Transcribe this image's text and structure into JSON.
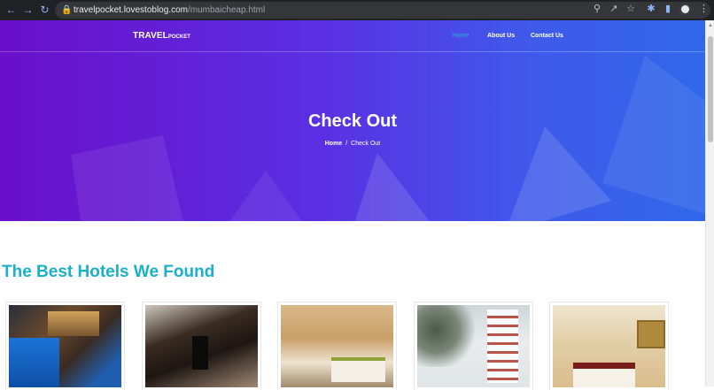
{
  "browser": {
    "url_host": "travelpocket.lovestoblog.com",
    "url_path": "/mumbaicheap.html",
    "icons": [
      "back-arrow-icon",
      "forward-arrow-icon",
      "reload-icon",
      "lock-icon",
      "zoom-icon",
      "share-icon",
      "star-icon",
      "extensions-icon",
      "side-panel-icon",
      "profile-avatar",
      "menu-dots-icon"
    ]
  },
  "site": {
    "logo_main": "TRAVEL",
    "logo_sub": "POCKET",
    "nav": {
      "home": "Home",
      "about": "About Us",
      "contact": "Contact Us"
    }
  },
  "hero": {
    "title": "Check Out",
    "breadcrumb": {
      "home": "Home",
      "separator": "/",
      "current": "Check Out"
    }
  },
  "content": {
    "section_title": "The Best Hotels We Found",
    "hotels": [
      {
        "image": "hotel-lobby-blue-wall"
      },
      {
        "image": "hotel-corridor-chandelier"
      },
      {
        "image": "hotel-room-arched"
      },
      {
        "image": "hotel-building-exterior"
      },
      {
        "image": "hotel-room-warm"
      }
    ]
  },
  "colors": {
    "accent": "#1ab0c9",
    "nav_active": "#22b8d6",
    "hero_start": "#6a0fc9",
    "hero_end": "#3168ea",
    "chrome_bg": "#202124"
  }
}
